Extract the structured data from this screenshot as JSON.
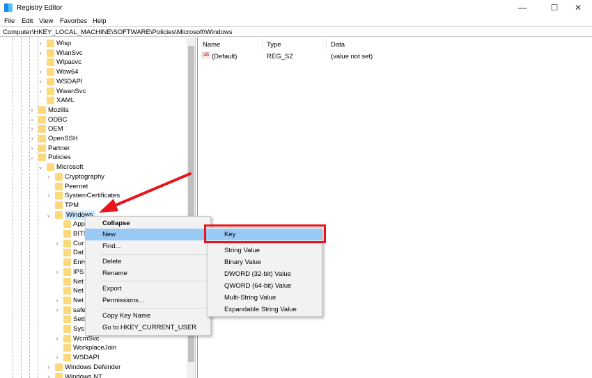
{
  "window": {
    "title": "Registry Editor",
    "minimize": "—",
    "maximize": "☐",
    "close": "✕"
  },
  "menubar": [
    "File",
    "Edit",
    "View",
    "Favorites",
    "Help"
  ],
  "address": "Computer\\HKEY_LOCAL_MACHINE\\SOFTWARE\\Policies\\Microsoft\\Windows",
  "tree": [
    {
      "label": "Wisp",
      "level": 3,
      "exp": ">"
    },
    {
      "label": "WlanSvc",
      "level": 3,
      "exp": ">"
    },
    {
      "label": "Wlpasvc",
      "level": 3,
      "exp": ""
    },
    {
      "label": "Wow64",
      "level": 3,
      "exp": ">"
    },
    {
      "label": "WSDAPI",
      "level": 3,
      "exp": ">"
    },
    {
      "label": "WwanSvc",
      "level": 3,
      "exp": ">"
    },
    {
      "label": "XAML",
      "level": 3,
      "exp": ""
    },
    {
      "label": "Mozilla",
      "level": 2,
      "exp": ">"
    },
    {
      "label": "ODBC",
      "level": 2,
      "exp": ">"
    },
    {
      "label": "OEM",
      "level": 2,
      "exp": ">"
    },
    {
      "label": "OpenSSH",
      "level": 2,
      "exp": ">"
    },
    {
      "label": "Partner",
      "level": 2,
      "exp": ">"
    },
    {
      "label": "Policies",
      "level": 2,
      "exp": "v"
    },
    {
      "label": "Microsoft",
      "level": 3,
      "exp": "v"
    },
    {
      "label": "Cryptography",
      "level": 4,
      "exp": ">"
    },
    {
      "label": "Peernet",
      "level": 4,
      "exp": ""
    },
    {
      "label": "SystemCertificates",
      "level": 4,
      "exp": ">"
    },
    {
      "label": "TPM",
      "level": 4,
      "exp": ""
    },
    {
      "label": "Windows",
      "level": 4,
      "exp": "v",
      "selected": true
    },
    {
      "label": "App",
      "level": 5,
      "exp": ""
    },
    {
      "label": "BITS",
      "level": 5,
      "exp": ""
    },
    {
      "label": "Cur",
      "level": 5,
      "exp": ">"
    },
    {
      "label": "Dat",
      "level": 5,
      "exp": ""
    },
    {
      "label": "EnH",
      "level": 5,
      "exp": ""
    },
    {
      "label": "IPS",
      "level": 5,
      "exp": ">"
    },
    {
      "label": "Net",
      "level": 5,
      "exp": ""
    },
    {
      "label": "Net",
      "level": 5,
      "exp": ""
    },
    {
      "label": "Net",
      "level": 5,
      "exp": ">"
    },
    {
      "label": "safe",
      "level": 5,
      "exp": ">"
    },
    {
      "label": "Sett",
      "level": 5,
      "exp": ""
    },
    {
      "label": "Sys",
      "level": 5,
      "exp": ""
    },
    {
      "label": "WcmSvc",
      "level": 5,
      "exp": ">"
    },
    {
      "label": "WorkplaceJoin",
      "level": 5,
      "exp": ""
    },
    {
      "label": "WSDAPI",
      "level": 5,
      "exp": ">"
    },
    {
      "label": "Windows Defender",
      "level": 4,
      "exp": ">"
    },
    {
      "label": "Windows NT",
      "level": 4,
      "exp": ">"
    }
  ],
  "values": {
    "columns": [
      "Name",
      "Type",
      "Data"
    ],
    "rows": [
      {
        "name": "(Default)",
        "type": "REG_SZ",
        "data": "(value not set)",
        "icon": "ab"
      }
    ]
  },
  "context_menu": {
    "items": [
      "Collapse",
      "New",
      "Find...",
      "Delete",
      "Rename",
      "Export",
      "Permissions...",
      "Copy Key Name",
      "Go to HKEY_CURRENT_USER"
    ],
    "highlighted": "New"
  },
  "submenu": {
    "items": [
      "Key",
      "String Value",
      "Binary Value",
      "DWORD (32-bit) Value",
      "QWORD (64-bit) Value",
      "Multi-String Value",
      "Expandable String Value"
    ],
    "highlighted": "Key"
  },
  "colors": {
    "highlight": "#99c9f5",
    "annotation": "#e8141b",
    "folder": "#fcd97d"
  }
}
